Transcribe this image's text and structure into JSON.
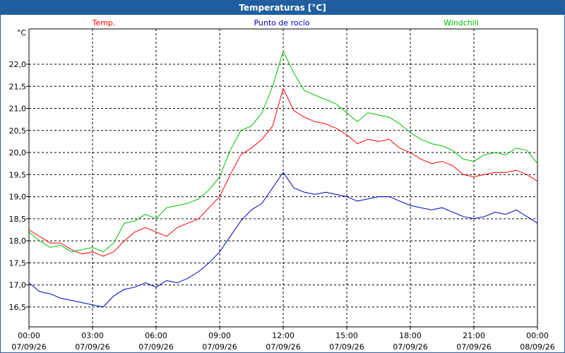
{
  "window": {
    "title": "Temperaturas [°C]"
  },
  "chart_data": {
    "type": "line",
    "unit": "°C",
    "ylim": [
      16.05,
      22.8
    ],
    "y_ticks": [
      16.5,
      17.0,
      17.5,
      18.0,
      18.5,
      19.0,
      19.5,
      20.0,
      20.5,
      21.0,
      21.5,
      22.0
    ],
    "y_tick_labels": [
      "16,5",
      "17,0",
      "17,5",
      "18,0",
      "18,5",
      "19,0",
      "19,5",
      "20,0",
      "20,5",
      "21,0",
      "21,5",
      "22,0"
    ],
    "x_ticks": [
      {
        "time": "00:00",
        "date": "07/09/26"
      },
      {
        "time": "03:00",
        "date": "07/09/26"
      },
      {
        "time": "06:00",
        "date": "07/09/26"
      },
      {
        "time": "09:00",
        "date": "07/09/26"
      },
      {
        "time": "12:00",
        "date": "07/09/26"
      },
      {
        "time": "15:00",
        "date": "07/09/26"
      },
      {
        "time": "18:00",
        "date": "07/09/26"
      },
      {
        "time": "21:00",
        "date": "07/09/26"
      },
      {
        "time": "00:00",
        "date": "08/09/26"
      }
    ],
    "x_hours_range": [
      0,
      24
    ],
    "grid": true,
    "legend_placement": "top",
    "series": [
      {
        "name": "Temp.",
        "color": "#ff0000",
        "points": [
          [
            0,
            18.25
          ],
          [
            0.5,
            18.1
          ],
          [
            1,
            17.95
          ],
          [
            1.5,
            17.95
          ],
          [
            2,
            17.8
          ],
          [
            2.5,
            17.7
          ],
          [
            3,
            17.75
          ],
          [
            3.5,
            17.65
          ],
          [
            4,
            17.75
          ],
          [
            4.5,
            18.0
          ],
          [
            5,
            18.2
          ],
          [
            5.5,
            18.3
          ],
          [
            6,
            18.2
          ],
          [
            6.5,
            18.1
          ],
          [
            7,
            18.3
          ],
          [
            7.5,
            18.4
          ],
          [
            8,
            18.5
          ],
          [
            8.5,
            18.75
          ],
          [
            9,
            19.0
          ],
          [
            9.5,
            19.5
          ],
          [
            10,
            19.95
          ],
          [
            10.5,
            20.1
          ],
          [
            11,
            20.3
          ],
          [
            11.5,
            20.6
          ],
          [
            12,
            21.45
          ],
          [
            12.5,
            20.95
          ],
          [
            13,
            20.8
          ],
          [
            13.5,
            20.7
          ],
          [
            14,
            20.65
          ],
          [
            14.5,
            20.55
          ],
          [
            15,
            20.4
          ],
          [
            15.5,
            20.2
          ],
          [
            16,
            20.3
          ],
          [
            16.5,
            20.25
          ],
          [
            17,
            20.3
          ],
          [
            17.5,
            20.1
          ],
          [
            18,
            20.0
          ],
          [
            18.5,
            19.85
          ],
          [
            19,
            19.75
          ],
          [
            19.5,
            19.8
          ],
          [
            20,
            19.7
          ],
          [
            20.5,
            19.5
          ],
          [
            21,
            19.45
          ],
          [
            21.5,
            19.5
          ],
          [
            22,
            19.55
          ],
          [
            22.5,
            19.55
          ],
          [
            23,
            19.6
          ],
          [
            23.5,
            19.5
          ],
          [
            24,
            19.35
          ]
        ]
      },
      {
        "name": "Punto de rocío",
        "color": "#0000c0",
        "points": [
          [
            0,
            17.05
          ],
          [
            0.5,
            16.85
          ],
          [
            1,
            16.8
          ],
          [
            1.5,
            16.7
          ],
          [
            2,
            16.65
          ],
          [
            2.5,
            16.6
          ],
          [
            3,
            16.55
          ],
          [
            3.5,
            16.5
          ],
          [
            4,
            16.75
          ],
          [
            4.5,
            16.9
          ],
          [
            5,
            16.95
          ],
          [
            5.5,
            17.05
          ],
          [
            6,
            16.95
          ],
          [
            6.5,
            17.1
          ],
          [
            7,
            17.05
          ],
          [
            7.5,
            17.15
          ],
          [
            8,
            17.3
          ],
          [
            8.5,
            17.5
          ],
          [
            9,
            17.75
          ],
          [
            9.5,
            18.1
          ],
          [
            10,
            18.45
          ],
          [
            10.5,
            18.7
          ],
          [
            11,
            18.85
          ],
          [
            11.5,
            19.2
          ],
          [
            12,
            19.55
          ],
          [
            12.5,
            19.2
          ],
          [
            13,
            19.1
          ],
          [
            13.5,
            19.05
          ],
          [
            14,
            19.1
          ],
          [
            14.5,
            19.05
          ],
          [
            15,
            19.0
          ],
          [
            15.5,
            18.9
          ],
          [
            16,
            18.95
          ],
          [
            16.5,
            19.0
          ],
          [
            17,
            19.0
          ],
          [
            17.5,
            18.9
          ],
          [
            18,
            18.8
          ],
          [
            18.5,
            18.75
          ],
          [
            19,
            18.7
          ],
          [
            19.5,
            18.75
          ],
          [
            20,
            18.65
          ],
          [
            20.5,
            18.55
          ],
          [
            21,
            18.5
          ],
          [
            21.5,
            18.55
          ],
          [
            22,
            18.65
          ],
          [
            22.5,
            18.6
          ],
          [
            23,
            18.7
          ],
          [
            23.5,
            18.55
          ],
          [
            24,
            18.4
          ]
        ]
      },
      {
        "name": "Windchill",
        "color": "#00c000",
        "points": [
          [
            0,
            18.2
          ],
          [
            0.5,
            18.0
          ],
          [
            1,
            17.85
          ],
          [
            1.5,
            17.9
          ],
          [
            2,
            17.75
          ],
          [
            2.5,
            17.8
          ],
          [
            3,
            17.85
          ],
          [
            3.5,
            17.75
          ],
          [
            4,
            17.95
          ],
          [
            4.5,
            18.4
          ],
          [
            5,
            18.45
          ],
          [
            5.5,
            18.6
          ],
          [
            6,
            18.5
          ],
          [
            6.5,
            18.75
          ],
          [
            7,
            18.8
          ],
          [
            7.5,
            18.85
          ],
          [
            8,
            18.95
          ],
          [
            8.5,
            19.15
          ],
          [
            9,
            19.45
          ],
          [
            9.5,
            20.05
          ],
          [
            10,
            20.5
          ],
          [
            10.5,
            20.6
          ],
          [
            11,
            20.9
          ],
          [
            11.5,
            21.5
          ],
          [
            12,
            22.3
          ],
          [
            12.5,
            21.8
          ],
          [
            13,
            21.4
          ],
          [
            13.5,
            21.3
          ],
          [
            14,
            21.2
          ],
          [
            14.5,
            21.1
          ],
          [
            15,
            20.9
          ],
          [
            15.5,
            20.7
          ],
          [
            16,
            20.9
          ],
          [
            16.5,
            20.85
          ],
          [
            17,
            20.8
          ],
          [
            17.5,
            20.65
          ],
          [
            18,
            20.45
          ],
          [
            18.5,
            20.3
          ],
          [
            19,
            20.2
          ],
          [
            19.5,
            20.15
          ],
          [
            20,
            20.05
          ],
          [
            20.5,
            19.85
          ],
          [
            21,
            19.8
          ],
          [
            21.5,
            19.95
          ],
          [
            22,
            20.0
          ],
          [
            22.5,
            19.95
          ],
          [
            23,
            20.1
          ],
          [
            23.5,
            20.05
          ],
          [
            24,
            19.75
          ]
        ]
      }
    ]
  }
}
